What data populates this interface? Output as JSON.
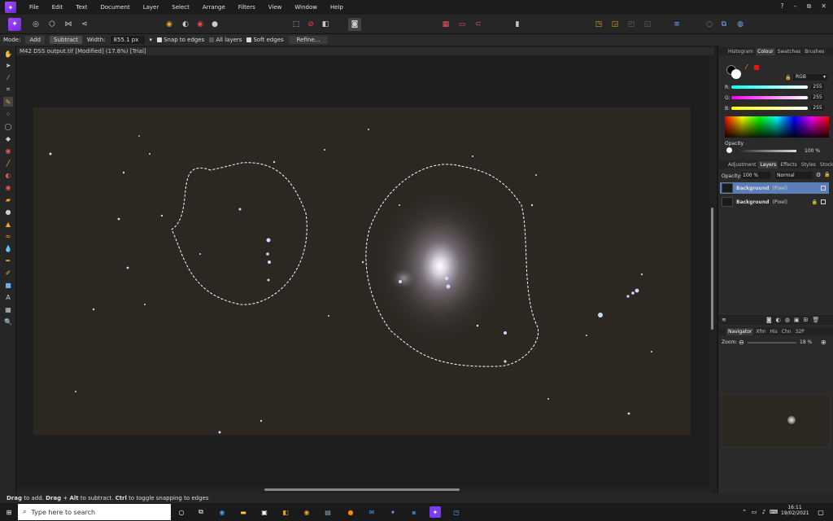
{
  "menu": [
    "File",
    "Edit",
    "Text",
    "Document",
    "Layer",
    "Select",
    "Arrange",
    "Filters",
    "View",
    "Window",
    "Help"
  ],
  "window_controls": {
    "help": "?",
    "minimize": "–",
    "restore": "⧉",
    "close": "✕"
  },
  "context": {
    "mode_label": "Mode:",
    "add": "Add",
    "subtract": "Subtract",
    "width_label": "Width:",
    "width_value": "855.1 px",
    "snap": "Snap to edges",
    "all_layers": "All layers",
    "soft_edges": "Soft edges",
    "refine": "Refine..."
  },
  "document_title": "M42 DSS output.tif [Modified] (17.8%) [Trial]",
  "status_bar": {
    "parts": [
      "Drag",
      " to add. ",
      "Drag",
      " + ",
      "Alt",
      " to subtract. ",
      "Ctrl",
      " to toggle snapping to edges"
    ]
  },
  "colour_panel": {
    "tabs": [
      "Histogram",
      "Colour",
      "Swatches",
      "Brushes"
    ],
    "active_tab": "Colour",
    "model": "RGB",
    "r_label": "R:",
    "g_label": "G:",
    "b_label": "B:",
    "r": "255",
    "g": "255",
    "b": "255",
    "opacity_label": "Opacity",
    "opacity": "100 %"
  },
  "layers_panel": {
    "tabs": [
      "Adjustment",
      "Layers",
      "Effects",
      "Styles",
      "Stock"
    ],
    "active_tab": "Layers",
    "opacity_label": "Opacity:",
    "opacity_value": "100 %",
    "blend_mode": "Normal",
    "layers": [
      {
        "name": "Background",
        "type": "(Pixel)",
        "selected": true
      },
      {
        "name": "Background",
        "type": "(Pixel)",
        "selected": false
      }
    ]
  },
  "navigator_panel": {
    "tabs": [
      "Navigator",
      "Xfm",
      "His",
      "Chn",
      "32P"
    ],
    "active_tab": "Navigator",
    "zoom_label": "Zoom:",
    "zoom_value": "18 %"
  },
  "taskbar": {
    "search_placeholder": "Type here to search",
    "time": "16:11",
    "date": "19/02/2021"
  },
  "colors": {
    "accent": "#7c3cf0",
    "selected_layer": "#5a7fb8",
    "nebula": "#d8d4e0",
    "star": "#ccd8ff"
  }
}
